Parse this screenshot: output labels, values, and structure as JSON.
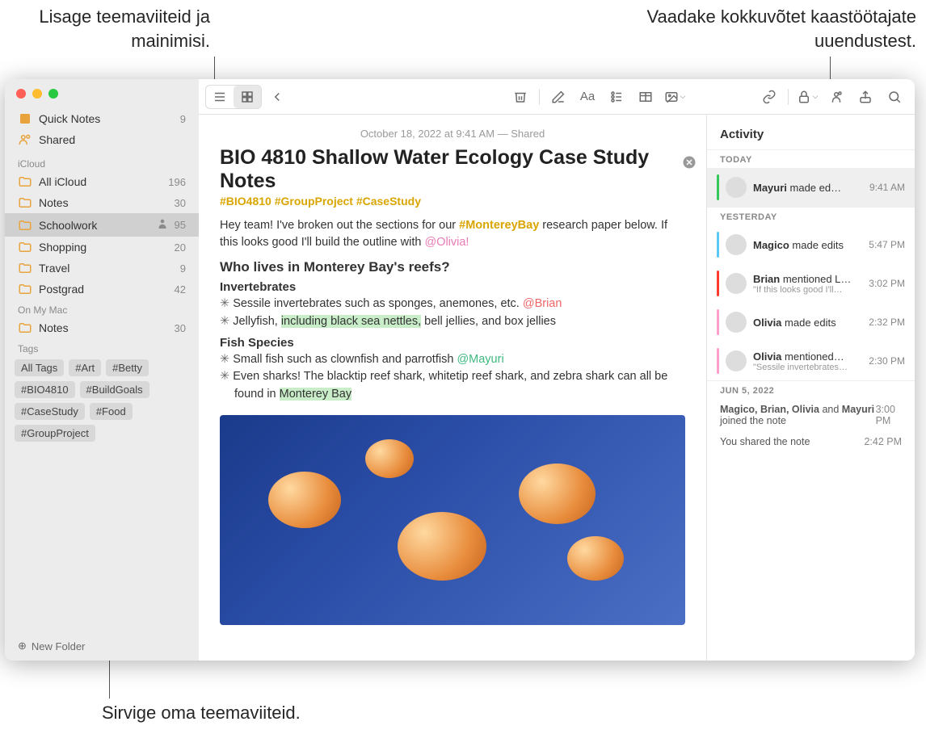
{
  "callouts": {
    "top_left": "Lisage teemaviiteid ja mainimisi.",
    "top_right": "Vaadake kokkuvõtet kaastöötajate uuendustest.",
    "bottom_left": "Sirvige oma teemaviiteid."
  },
  "sidebar": {
    "top": [
      {
        "icon": "quick-notes-icon",
        "label": "Quick Notes",
        "count": "9"
      },
      {
        "icon": "shared-icon",
        "label": "Shared",
        "count": ""
      }
    ],
    "sections": [
      {
        "header": "iCloud",
        "items": [
          {
            "label": "All iCloud",
            "count": "196",
            "shared": false
          },
          {
            "label": "Notes",
            "count": "30",
            "shared": false
          },
          {
            "label": "Schoolwork",
            "count": "95",
            "shared": true,
            "selected": true
          },
          {
            "label": "Shopping",
            "count": "20",
            "shared": false
          },
          {
            "label": "Travel",
            "count": "9",
            "shared": false
          },
          {
            "label": "Postgrad",
            "count": "42",
            "shared": false
          }
        ]
      },
      {
        "header": "On My Mac",
        "items": [
          {
            "label": "Notes",
            "count": "30",
            "shared": false
          }
        ]
      }
    ],
    "tags_header": "Tags",
    "tags": [
      "All Tags",
      "#Art",
      "#Betty",
      "#BIO4810",
      "#BuildGoals",
      "#CaseStudy",
      "#Food",
      "#GroupProject"
    ],
    "new_folder": "New Folder"
  },
  "note": {
    "date": "October 18, 2022 at 9:41 AM — Shared",
    "title": "BIO 4810 Shallow Water Ecology Case Study Notes",
    "tagline": "#BIO4810 #GroupProject #CaseStudy",
    "intro_pre": "Hey team! I've broken out the sections for our ",
    "intro_tag": "#MontereyBay",
    "intro_mid": " research paper below. If this looks good I'll build the outline with ",
    "intro_mention": "@Olivia!",
    "h2": "Who lives in Monterey Bay's reefs?",
    "h3a": "Invertebrates",
    "li1_pre": "Sessile invertebrates such as sponges, anemones, etc. ",
    "li1_mention": "@Brian",
    "li2_pre": "Jellyfish, ",
    "li2_hl": "including black sea nettles,",
    "li2_post": " bell jellies, and box jellies",
    "h3b": "Fish Species",
    "li3_pre": "Small fish such as clownfish and parrotfish ",
    "li3_mention": "@Mayuri",
    "li4_pre": "Even sharks! The blacktip reef shark, whitetip reef shark, and zebra shark can all be found in ",
    "li4_hl": "Monterey Bay"
  },
  "activity": {
    "title": "Activity",
    "sections": [
      {
        "header": "TODAY",
        "items": [
          {
            "bar": "#34c759",
            "name": "Mayuri",
            "action": " made ed…",
            "time": "9:41 AM",
            "sub": "",
            "selected": true
          }
        ]
      },
      {
        "header": "YESTERDAY",
        "items": [
          {
            "bar": "#5cc8f7",
            "name": "Magico",
            "action": " made edits",
            "time": "5:47 PM",
            "sub": ""
          },
          {
            "bar": "#ff3b30",
            "name": "Brian",
            "action": " mentioned L…",
            "time": "3:02 PM",
            "sub": "\"If this looks good I'll…"
          },
          {
            "bar": "#ff9ecb",
            "name": "Olivia",
            "action": " made edits",
            "time": "2:32 PM",
            "sub": ""
          },
          {
            "bar": "#ff9ecb",
            "name": "Olivia",
            "action": " mentioned…",
            "time": "2:30 PM",
            "sub": "\"Sessile invertebrates…"
          }
        ]
      }
    ],
    "history": {
      "header": "JUN 5, 2022",
      "line1a": "Magico, Brian, Olivia ",
      "line1b": "and ",
      "line1c": "Mayuri ",
      "line1d": "joined the note",
      "time1": "3:00 PM",
      "line2": "You shared the note",
      "time2": "2:42 PM"
    }
  }
}
